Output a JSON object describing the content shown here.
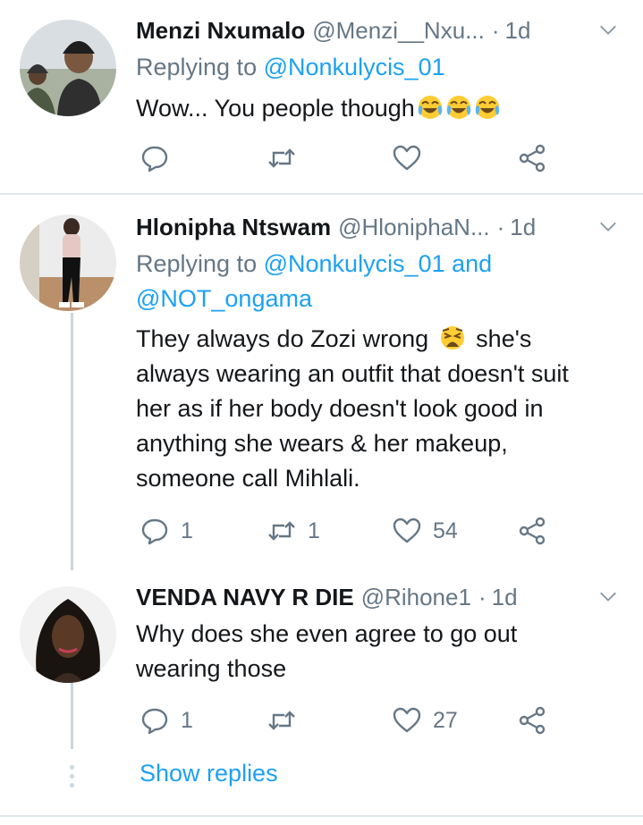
{
  "tweets": [
    {
      "name": "Menzi Nxumalo",
      "handle": "@Menzi__Nxu...",
      "dot": "·",
      "time": "1d",
      "replying_label": "Replying to",
      "mentions": [
        "@Nonkulycis_01"
      ],
      "text": "Wow... You people though",
      "emojis": [
        "face-with-tears-of-joy",
        "face-with-tears-of-joy",
        "face-with-tears-of-joy"
      ],
      "reply_count": "",
      "retweet_count": "",
      "like_count": ""
    },
    {
      "name": "Hlonipha Ntswam",
      "handle": "@HloniphaN...",
      "dot": "·",
      "time": "1d",
      "replying_label": "Replying to",
      "mentions": [
        "@Nonkulycis_01",
        "@NOT_ongama"
      ],
      "and_word": "and",
      "text_lines": [
        "They always do Zozi wrong",
        "always wearing an outfit that doesn't suit",
        "her as if her body doesn't look good in",
        "anything she wears & her makeup,",
        "someone call Mihlali."
      ],
      "text_after_emoji": "she's",
      "emoji": "weary-face",
      "reply_count": "1",
      "retweet_count": "1",
      "like_count": "54"
    },
    {
      "name": "VENDA NAVY R DIE",
      "handle": "@Rihone1",
      "dot": "·",
      "time": "1d",
      "text_lines": [
        "Why does she even agree to go out",
        "wearing those"
      ],
      "reply_count": "1",
      "retweet_count": "",
      "like_count": "27"
    }
  ],
  "show_replies": "Show replies",
  "colors": {
    "link": "#1da1f2",
    "muted": "#657786",
    "text": "#14171a",
    "divider": "#e1e8ed",
    "thread": "#ccd6dd"
  }
}
